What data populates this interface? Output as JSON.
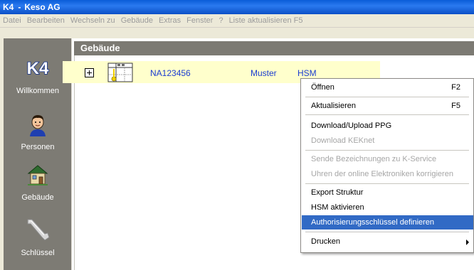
{
  "titlebar": {
    "app_logo": "K4",
    "separator": "-",
    "title": "Keso AG"
  },
  "menubar": {
    "items": [
      "Datei",
      "Bearbeiten",
      "Wechseln zu",
      "Gebäude",
      "Extras",
      "Fenster",
      "?",
      "Liste aktualisieren F5"
    ]
  },
  "sidebar": {
    "items": [
      {
        "label": "Willkommen",
        "icon": "k4-logo-icon",
        "icon_text": "K4"
      },
      {
        "label": "Personen",
        "icon": "person-icon"
      },
      {
        "label": "Gebäude",
        "icon": "house-icon"
      },
      {
        "label": "Schlüssel",
        "icon": "key-icon"
      }
    ]
  },
  "panel": {
    "header": "Gebäude"
  },
  "tree": {
    "row": {
      "id": "NA123456",
      "name": "Muster",
      "type": "HSM"
    }
  },
  "context_menu": {
    "items": [
      {
        "label": "Öffnen",
        "shortcut": "F2",
        "state": "normal"
      },
      {
        "label": "Aktualisieren",
        "shortcut": "F5",
        "state": "normal"
      },
      {
        "label": "Download/Upload PPG",
        "shortcut": "",
        "state": "normal"
      },
      {
        "label": "Download KEKnet",
        "shortcut": "",
        "state": "disabled"
      },
      {
        "label": "Sende Bezeichnungen zu K-Service",
        "shortcut": "",
        "state": "disabled"
      },
      {
        "label": "Uhren der online Elektroniken korrigieren",
        "shortcut": "",
        "state": "disabled"
      },
      {
        "label": "Export Struktur",
        "shortcut": "",
        "state": "normal"
      },
      {
        "label": "HSM aktivieren",
        "shortcut": "",
        "state": "normal"
      },
      {
        "label": "Authorisierungsschlüssel definieren",
        "shortcut": "",
        "state": "selected"
      },
      {
        "label": "Drucken",
        "shortcut": "",
        "state": "normal",
        "submenu": true
      }
    ]
  },
  "colors": {
    "titlebar": "#0a5cd8",
    "sidebar": "#7d7b74",
    "selection": "#316ac5",
    "link_text": "#1a3cd0",
    "row_highlight": "#ffffcc"
  }
}
